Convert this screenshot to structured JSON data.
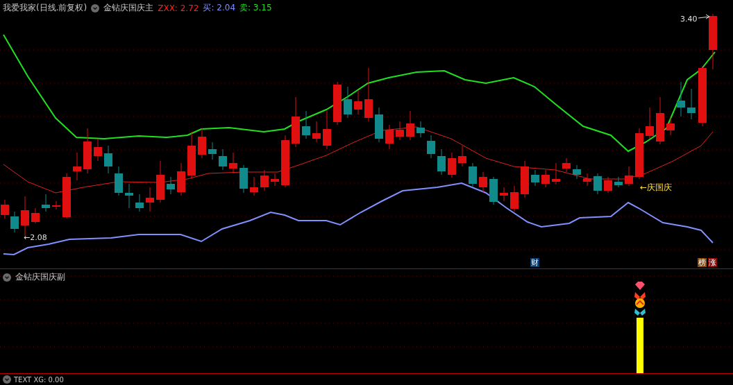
{
  "main_panel": {
    "title": "我爱我家(日线.前复权)",
    "indicator": "金钻庆国庆主",
    "readings": [
      {
        "label": "ZXX: 2.72",
        "color": "#ff2020"
      },
      {
        "label": "买: 2.04",
        "color": "#8090ff"
      },
      {
        "label": "卖: 3.15",
        "color": "#20e020"
      }
    ],
    "high_label": "3.40",
    "low_label": "←2.08",
    "signal_label": "←庆国庆",
    "markers": [
      {
        "text": "财",
        "color": "#0a3a6a"
      },
      {
        "text": "榜",
        "color": "#8a4a0a"
      },
      {
        "text": "涨",
        "color": "#8a0a0a"
      }
    ]
  },
  "sub_panel": {
    "indicator": "金钻庆国庆副"
  },
  "bottom_panel": {
    "label": "TEXT XG: 0.00"
  }
}
